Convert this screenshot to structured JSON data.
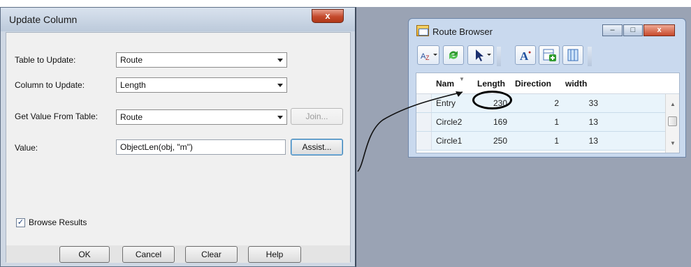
{
  "update_dialog": {
    "title": "Update Column",
    "close_label": "x",
    "table_label": "Table to Update:",
    "table_value": "Route",
    "column_label": "Column to Update:",
    "column_value": "Length",
    "get_value_label": "Get Value From Table:",
    "get_value_value": "Route",
    "join_label": "Join...",
    "value_label": "Value:",
    "value_text": "ObjectLen(obj, \"m\")",
    "assist_label": "Assist...",
    "browse_results_label": "Browse Results",
    "browse_results_checked": true,
    "ok_label": "OK",
    "cancel_label": "Cancel",
    "clear_label": "Clear",
    "help_label": "Help"
  },
  "route_browser": {
    "title": "Route Browser",
    "minimize_label": "–",
    "maximize_label": "□",
    "close_label": "x",
    "toolbar_icons": [
      "sort-filter-icon",
      "refresh-icon",
      "pointer-select-icon",
      "font-style-icon",
      "add-column-icon",
      "column-properties-icon"
    ],
    "columns": [
      "Nam",
      "Length",
      "Direction",
      "width"
    ],
    "rows": [
      {
        "name": "Entry",
        "length": "230",
        "direction": "2",
        "width": "33"
      },
      {
        "name": "Circle2",
        "length": "169",
        "direction": "1",
        "width": "13"
      },
      {
        "name": "Circle1",
        "length": "250",
        "direction": "1",
        "width": "13"
      }
    ]
  }
}
